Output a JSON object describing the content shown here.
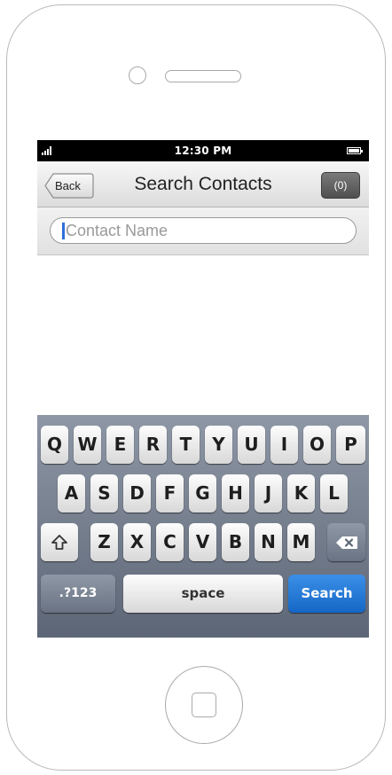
{
  "status_bar": {
    "time": "12:30 PM"
  },
  "nav": {
    "back_label": "Back",
    "title": "Search Contacts",
    "count_label": "(0)"
  },
  "search": {
    "placeholder": "Contact Name",
    "value": ""
  },
  "keyboard": {
    "row1": [
      "Q",
      "W",
      "E",
      "R",
      "T",
      "Y",
      "U",
      "I",
      "O",
      "P"
    ],
    "row2": [
      "A",
      "S",
      "D",
      "F",
      "G",
      "H",
      "J",
      "K",
      "L"
    ],
    "row3": [
      "Z",
      "X",
      "C",
      "V",
      "B",
      "N",
      "M"
    ],
    "shift_icon": "shift-arrow",
    "delete_icon": "backspace",
    "numbers_label": ".?123",
    "space_label": "space",
    "search_label": "Search"
  },
  "colors": {
    "accent": "#2f6ed8",
    "search_key": "#1f74d6",
    "keyboard_bg": "#6b7484",
    "status_bar": "#000000"
  },
  "icons": [
    "signal-icon",
    "battery-icon",
    "shift-icon",
    "delete-icon",
    "home-button-icon"
  ]
}
